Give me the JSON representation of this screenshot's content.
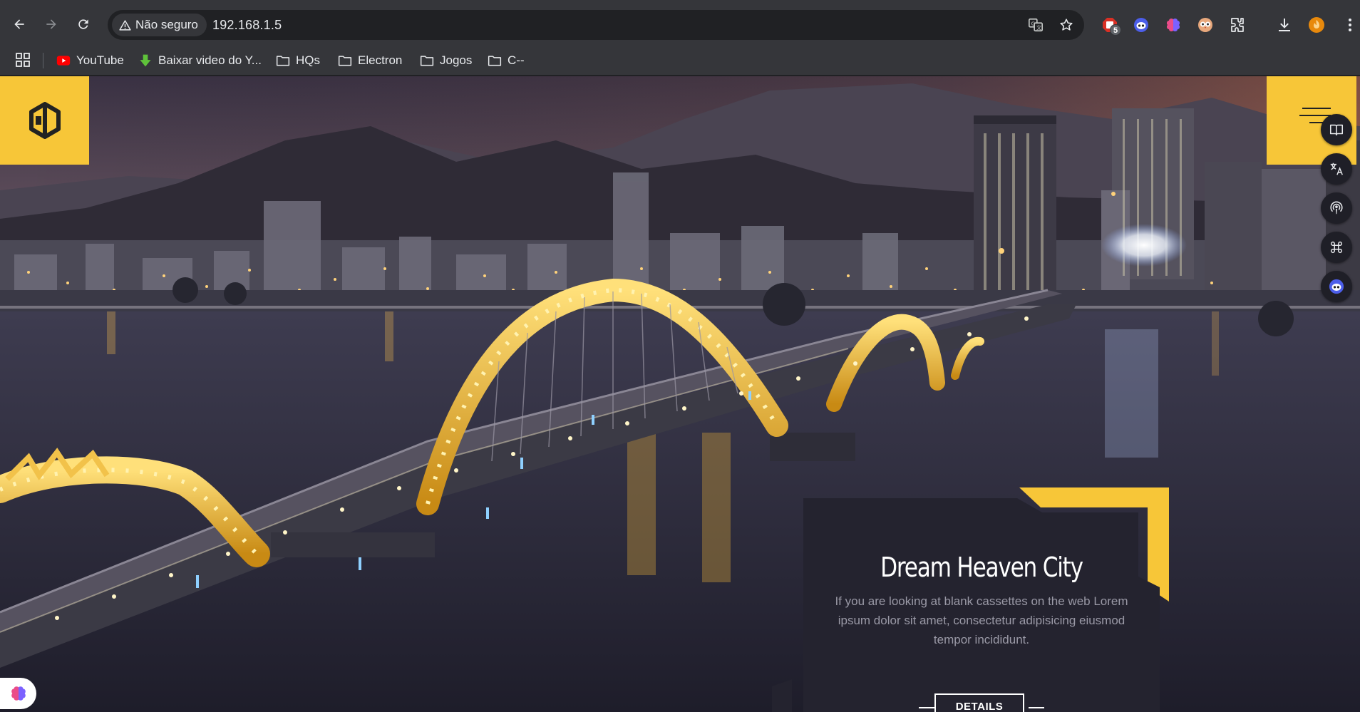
{
  "browser": {
    "security_label": "Não seguro",
    "url": "192.168.1.5",
    "extensions": {
      "badge_count": "5"
    },
    "bookmarks": [
      {
        "label": "YouTube",
        "icon": "youtube-icon"
      },
      {
        "label": "Baixar video do Y...",
        "icon": "download-arrow-icon"
      },
      {
        "label": "HQs",
        "icon": "folder-icon"
      },
      {
        "label": "Electron",
        "icon": "folder-icon"
      },
      {
        "label": "Jogos",
        "icon": "folder-icon"
      },
      {
        "label": "C--",
        "icon": "folder-icon"
      }
    ]
  },
  "page": {
    "hero_card": {
      "title": "Dream Heaven City",
      "body": "If you are looking at blank cassettes on the web Lorem ipsum dolor sit amet, consectetur adipisicing eiusmod tempor incididunt.",
      "button_label": "DETAILS"
    },
    "colors": {
      "accent": "#f7c638",
      "card_bg": "#24232f",
      "browser_frame": "#35363a",
      "omnibox": "#202124"
    },
    "side_rail_icons": [
      "book-icon",
      "translate-icon",
      "podcast-icon",
      "command-icon",
      "robot-icon"
    ]
  }
}
